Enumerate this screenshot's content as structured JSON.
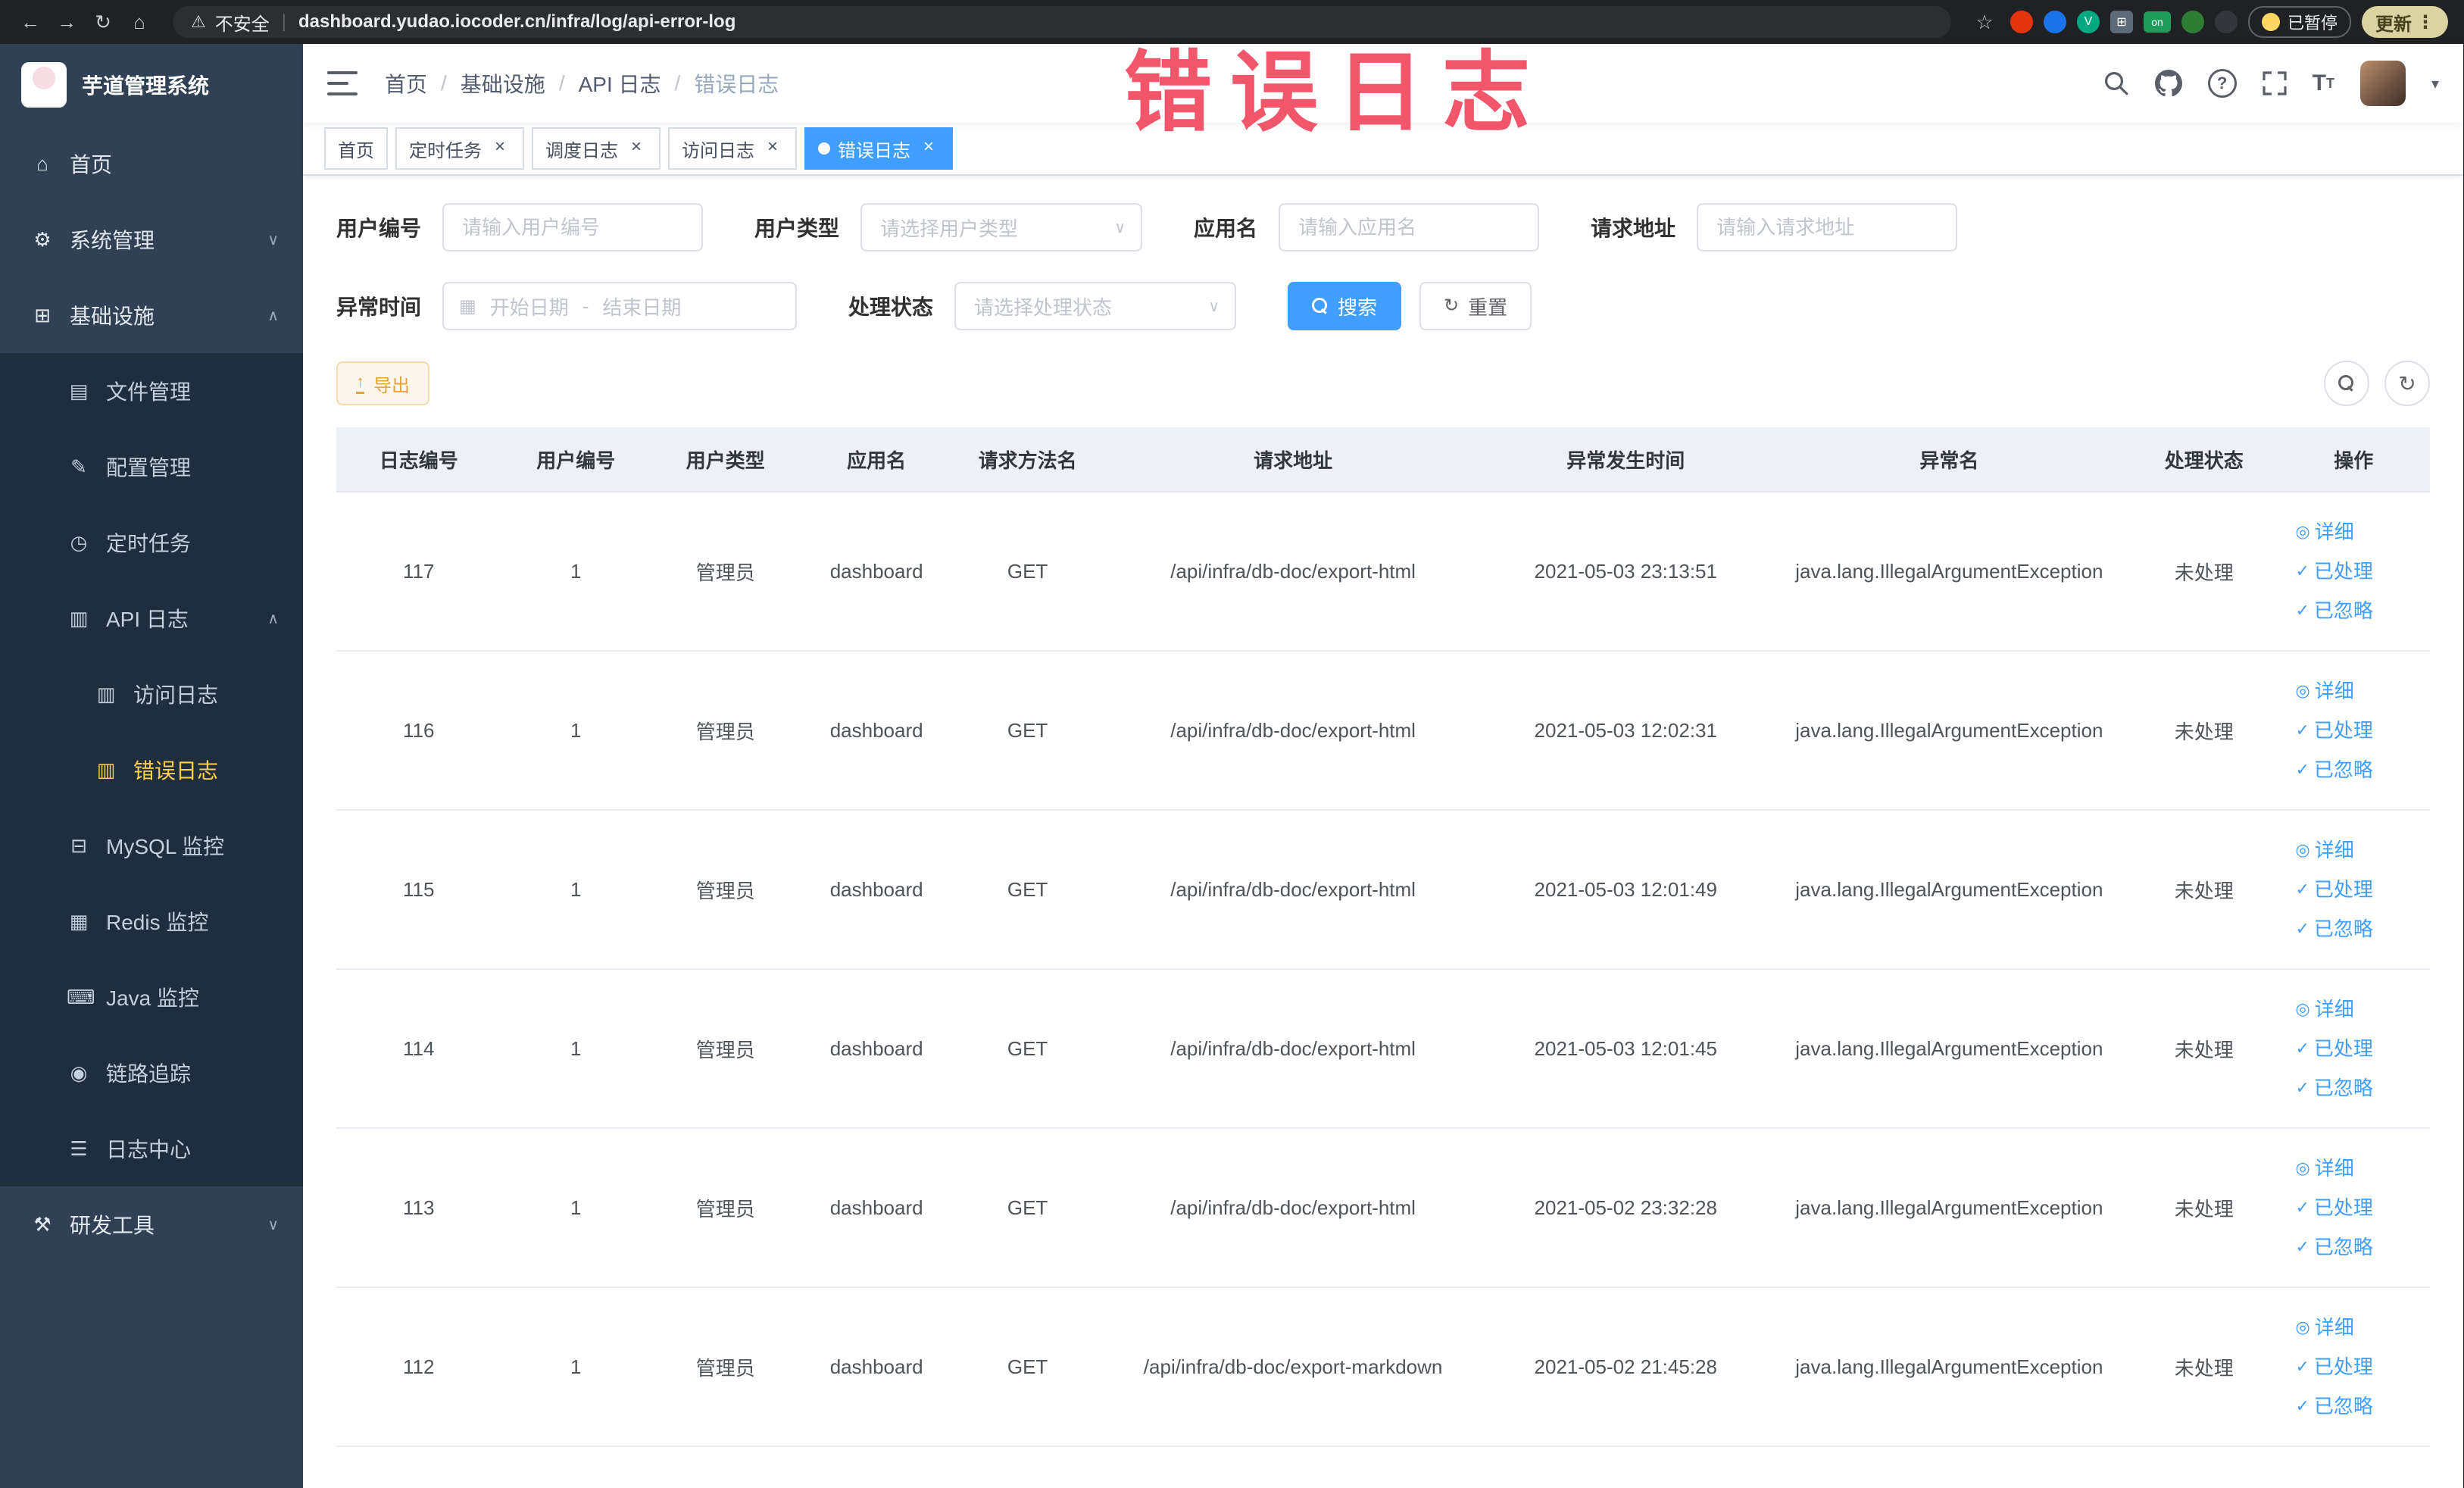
{
  "watermark": "错误日志",
  "browser": {
    "security_label": "不安全",
    "url": "dashboard.yudao.iocoder.cn/infra/log/api-error-log",
    "extension_on_label": "on",
    "paused_label": "已暂停",
    "update_label": "更新"
  },
  "sidebar": {
    "logo_title": "芋道管理系统",
    "items": [
      {
        "label": "首页",
        "icon": "home-icon",
        "level": 1
      },
      {
        "label": "系统管理",
        "icon": "gear-icon",
        "level": 1,
        "chevron": "down"
      },
      {
        "label": "基础设施",
        "icon": "infra-icon",
        "level": 1,
        "chevron": "up"
      },
      {
        "label": "文件管理",
        "icon": "file-icon",
        "level": 2
      },
      {
        "label": "配置管理",
        "icon": "config-icon",
        "level": 2
      },
      {
        "label": "定时任务",
        "icon": "job-icon",
        "level": 2
      },
      {
        "label": "API 日志",
        "icon": "api-log-icon",
        "level": 2,
        "chevron": "up"
      },
      {
        "label": "访问日志",
        "icon": "access-log-icon",
        "level": 3
      },
      {
        "label": "错误日志",
        "icon": "error-log-icon",
        "level": 3,
        "active": true
      },
      {
        "label": "MySQL 监控",
        "icon": "mysql-icon",
        "level": 2
      },
      {
        "label": "Redis 监控",
        "icon": "redis-icon",
        "level": 2
      },
      {
        "label": "Java 监控",
        "icon": "java-icon",
        "level": 2
      },
      {
        "label": "链路追踪",
        "icon": "trace-icon",
        "level": 2
      },
      {
        "label": "日志中心",
        "icon": "log-center-icon",
        "level": 2
      },
      {
        "label": "研发工具",
        "icon": "tool-icon",
        "level": 1,
        "chevron": "down"
      }
    ]
  },
  "header": {
    "breadcrumb": [
      "首页",
      "基础设施",
      "API 日志",
      "错误日志"
    ]
  },
  "tabs": [
    {
      "label": "首页",
      "closable": false,
      "active": false
    },
    {
      "label": "定时任务",
      "closable": true,
      "active": false
    },
    {
      "label": "调度日志",
      "closable": true,
      "active": false
    },
    {
      "label": "访问日志",
      "closable": true,
      "active": false
    },
    {
      "label": "错误日志",
      "closable": true,
      "active": true
    }
  ],
  "filters": {
    "user_id": {
      "label": "用户编号",
      "placeholder": "请输入用户编号"
    },
    "user_type": {
      "label": "用户类型",
      "placeholder": "请选择用户类型"
    },
    "app_name": {
      "label": "应用名",
      "placeholder": "请输入应用名"
    },
    "request_url": {
      "label": "请求地址",
      "placeholder": "请输入请求地址"
    },
    "exception_time": {
      "label": "异常时间",
      "start_placeholder": "开始日期",
      "separator": "-",
      "end_placeholder": "结束日期"
    },
    "process_status": {
      "label": "处理状态",
      "placeholder": "请选择处理状态"
    },
    "search_button": "搜索",
    "reset_button": "重置"
  },
  "toolbar": {
    "export_button": "导出"
  },
  "table": {
    "headers": [
      "日志编号",
      "用户编号",
      "用户类型",
      "应用名",
      "请求方法名",
      "请求地址",
      "异常发生时间",
      "异常名",
      "处理状态",
      "操作"
    ],
    "actions": [
      {
        "label": "详细",
        "icon": "view-icon",
        "name": "detail-link"
      },
      {
        "label": "已处理",
        "icon": "check-icon",
        "name": "processed-link"
      },
      {
        "label": "已忽略",
        "icon": "check-icon",
        "name": "ignored-link"
      }
    ],
    "rows": [
      {
        "id": "117",
        "user_id": "1",
        "user_type": "管理员",
        "app": "dashboard",
        "method": "GET",
        "url": "/api/infra/db-doc/export-html",
        "time": "2021-05-03 23:13:51",
        "exception": "java.lang.IllegalArgumentException",
        "status": "未处理"
      },
      {
        "id": "116",
        "user_id": "1",
        "user_type": "管理员",
        "app": "dashboard",
        "method": "GET",
        "url": "/api/infra/db-doc/export-html",
        "time": "2021-05-03 12:02:31",
        "exception": "java.lang.IllegalArgumentException",
        "status": "未处理"
      },
      {
        "id": "115",
        "user_id": "1",
        "user_type": "管理员",
        "app": "dashboard",
        "method": "GET",
        "url": "/api/infra/db-doc/export-html",
        "time": "2021-05-03 12:01:49",
        "exception": "java.lang.IllegalArgumentException",
        "status": "未处理"
      },
      {
        "id": "114",
        "user_id": "1",
        "user_type": "管理员",
        "app": "dashboard",
        "method": "GET",
        "url": "/api/infra/db-doc/export-html",
        "time": "2021-05-03 12:01:45",
        "exception": "java.lang.IllegalArgumentException",
        "status": "未处理"
      },
      {
        "id": "113",
        "user_id": "1",
        "user_type": "管理员",
        "app": "dashboard",
        "method": "GET",
        "url": "/api/infra/db-doc/export-html",
        "time": "2021-05-02 23:32:28",
        "exception": "java.lang.IllegalArgumentException",
        "status": "未处理"
      },
      {
        "id": "112",
        "user_id": "1",
        "user_type": "管理员",
        "app": "dashboard",
        "method": "GET",
        "url": "/api/infra/db-doc/export-markdown",
        "time": "2021-05-02 21:45:28",
        "exception": "java.lang.IllegalArgumentException",
        "status": "未处理"
      }
    ]
  },
  "icons": {
    "home-icon": "⌂",
    "gear-icon": "⚙",
    "infra-icon": "⊞",
    "file-icon": "▤",
    "config-icon": "✎",
    "job-icon": "◷",
    "api-log-icon": "▥",
    "access-log-icon": "▥",
    "error-log-icon": "▥",
    "mysql-icon": "⊟",
    "redis-icon": "▦",
    "java-icon": "⌨",
    "trace-icon": "◉",
    "log-center-icon": "☰",
    "tool-icon": "⚒",
    "chevron-up": "∧",
    "chevron-down": "∨",
    "view-icon": "◎",
    "check-icon": "✓",
    "calendar-icon": "▦",
    "refresh-icon": "↻",
    "settings-icon": "⚙"
  }
}
